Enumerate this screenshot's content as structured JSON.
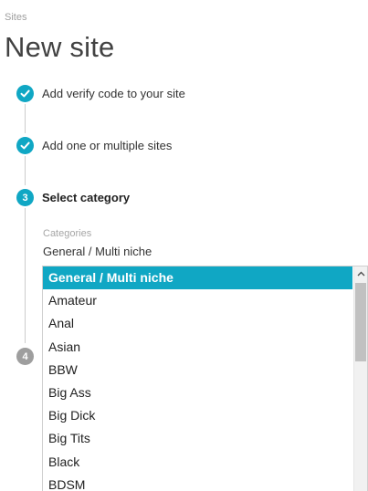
{
  "breadcrumb": "Sites",
  "page_title": "New site",
  "steps": [
    {
      "status": "done",
      "label": "Add verify code to your site"
    },
    {
      "status": "done",
      "label": "Add one or multiple sites"
    },
    {
      "status": "active",
      "number": "3",
      "label": "Select category"
    },
    {
      "status": "pending",
      "number": "4",
      "label": ""
    }
  ],
  "category_field": {
    "label": "Categories",
    "value": "General / Multi niche",
    "options": [
      "General / Multi niche",
      "Amateur",
      "Anal",
      "Asian",
      "BBW",
      "Big Ass",
      "Big Dick",
      "Big Tits",
      "Black",
      "BDSM"
    ],
    "selected_index": 0
  },
  "colors": {
    "accent": "#10a7c4",
    "pending": "#9e9e9e"
  },
  "icons": {
    "done": "check-icon",
    "scroll_up": "chevron-up-icon"
  }
}
